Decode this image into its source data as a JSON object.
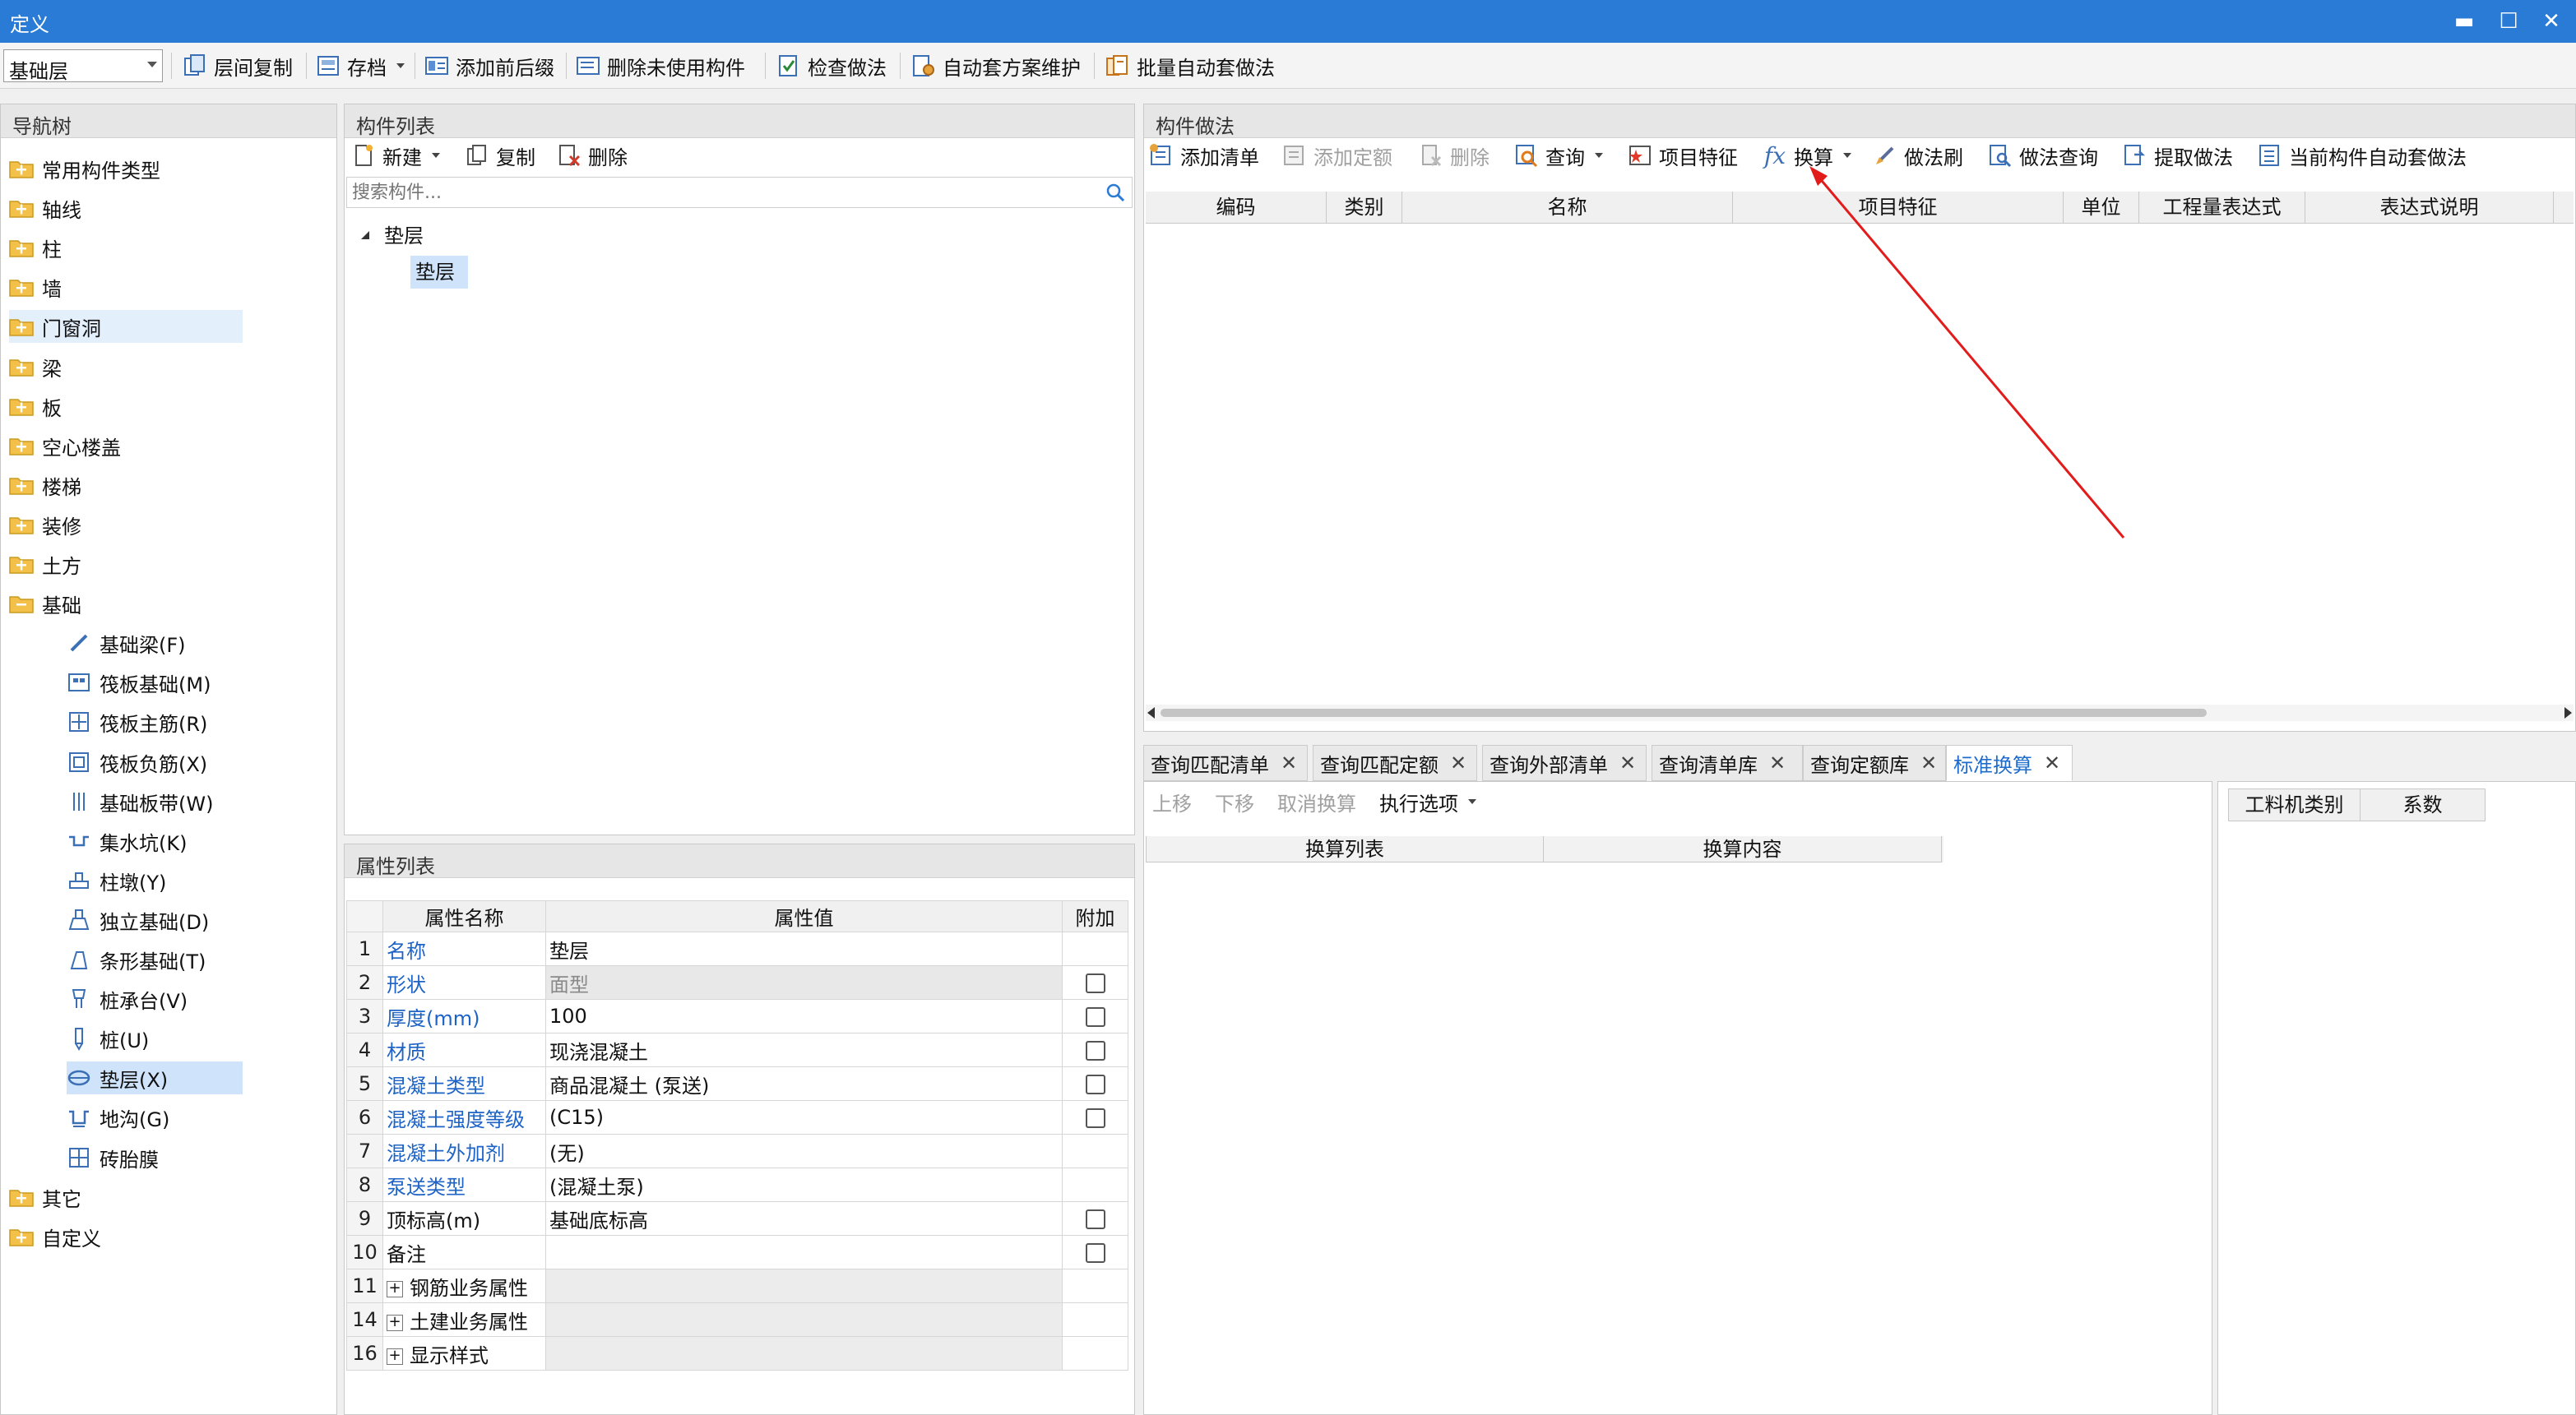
{
  "window": {
    "title": "定义",
    "minimize": "▬",
    "maximize": "☐",
    "close": "✕"
  },
  "toolbar": {
    "layer_value": "基础层",
    "buttons": [
      "层间复制",
      "存档",
      "添加前后缀",
      "删除未使用构件",
      "检查做法",
      "自动套方案维护",
      "批量自动套做法"
    ]
  },
  "nav": {
    "title": "导航树",
    "categories": [
      "常用构件类型",
      "轴线",
      "柱",
      "墙",
      "门窗洞",
      "梁",
      "板",
      "空心楼盖",
      "楼梯",
      "装修",
      "土方",
      "基础",
      "其它",
      "自定义"
    ],
    "foundation_children": [
      "基础梁(F)",
      "筏板基础(M)",
      "筏板主筋(R)",
      "筏板负筋(X)",
      "基础板带(W)",
      "集水坑(K)",
      "柱墩(Y)",
      "独立基础(D)",
      "条形基础(T)",
      "桩承台(V)",
      "桩(U)",
      "垫层(X)",
      "地沟(G)",
      "砖胎膜"
    ]
  },
  "component_list": {
    "title": "构件列表",
    "new_label": "新建",
    "copy_label": "复制",
    "delete_label": "删除",
    "search_placeholder": "搜索构件...",
    "tree_parent": "垫层",
    "tree_child": "垫层"
  },
  "properties": {
    "title": "属性列表",
    "headers": [
      "属性名称",
      "属性值",
      "附加"
    ],
    "rows": [
      {
        "no": "1",
        "name": "名称",
        "value": "垫层"
      },
      {
        "no": "2",
        "name": "形状",
        "value": "面型"
      },
      {
        "no": "3",
        "name": "厚度(mm)",
        "value": "100"
      },
      {
        "no": "4",
        "name": "材质",
        "value": "现浇混凝土"
      },
      {
        "no": "5",
        "name": "混凝土类型",
        "value": "商品混凝土 (泵送)"
      },
      {
        "no": "6",
        "name": "混凝土强度等级",
        "value": "(C15)"
      },
      {
        "no": "7",
        "name": "混凝土外加剂",
        "value": "(无)"
      },
      {
        "no": "8",
        "name": "泵送类型",
        "value": "(混凝土泵)"
      },
      {
        "no": "9",
        "name": "顶标高(m)",
        "value": "基础底标高"
      },
      {
        "no": "10",
        "name": "备注",
        "value": ""
      },
      {
        "no": "11",
        "name": "钢筋业务属性",
        "value": ""
      },
      {
        "no": "14",
        "name": "土建业务属性",
        "value": ""
      },
      {
        "no": "16",
        "name": "显示样式",
        "value": ""
      }
    ]
  },
  "method": {
    "title": "构件做法",
    "toolbar": [
      "添加清单",
      "添加定额",
      "删除",
      "查询",
      "项目特征",
      "换算",
      "做法刷",
      "做法查询",
      "提取做法",
      "当前构件自动套做法"
    ],
    "columns": [
      "编码",
      "类别",
      "名称",
      "项目特征",
      "单位",
      "工程量表达式",
      "表达式说明"
    ]
  },
  "bottom_tabs": [
    "查询匹配清单",
    "查询匹配定额",
    "查询外部清单",
    "查询清单库",
    "查询定额库",
    "标准换算"
  ],
  "conversion": {
    "toolbar": [
      "上移",
      "下移",
      "取消换算",
      "执行选项"
    ],
    "columns": [
      "换算列表",
      "换算内容"
    ],
    "right_columns": [
      "工料机类别",
      "系数"
    ]
  }
}
